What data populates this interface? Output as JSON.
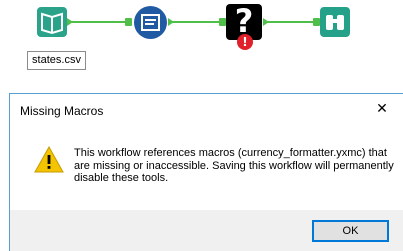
{
  "workflow": {
    "file_label": "states.csv",
    "tools": [
      {
        "name": "input-data",
        "icon": "book-icon",
        "color": "#2aa38a"
      },
      {
        "name": "select",
        "icon": "select-list-icon",
        "color": "#1f5aa3"
      },
      {
        "name": "missing-macro",
        "icon": "question-mark-icon",
        "color": "#000000"
      },
      {
        "name": "browse",
        "icon": "binoculars-icon",
        "color": "#25a18a"
      }
    ],
    "connection_color": "#4fbf4a",
    "macro_glyph": "?",
    "error_badge": "!"
  },
  "dialog": {
    "title": "Missing Macros",
    "close_glyph": "✕",
    "message": "This workflow references macros (currency_formatter.yxmc) that are missing or inaccessible. Saving this workflow will permanently disable these tools.",
    "ok_label": "OK",
    "warning_icon": "warning-icon"
  }
}
